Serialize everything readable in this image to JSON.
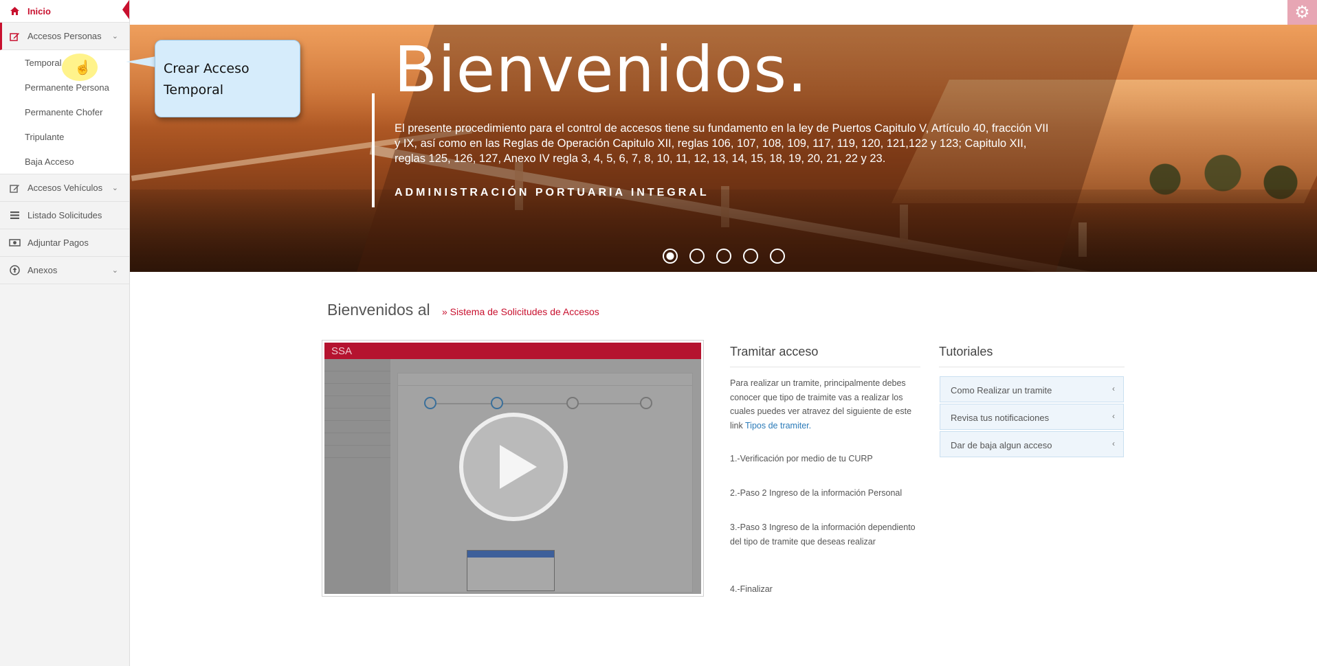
{
  "sidebar": {
    "home": {
      "label": "Inicio",
      "icon": "home-icon"
    },
    "items": [
      {
        "label": "Accesos Personas",
        "icon": "edit-icon",
        "expanded": true,
        "children": [
          "Temporal",
          "Permanente Persona",
          "Permanente Chofer",
          "Tripulante",
          "Baja Acceso"
        ]
      },
      {
        "label": "Accesos Vehículos",
        "icon": "edit-icon"
      },
      {
        "label": "Listado Solicitudes",
        "icon": "list-icon"
      },
      {
        "label": "Adjuntar Pagos",
        "icon": "money-icon"
      },
      {
        "label": "Anexos",
        "icon": "upload-circle-icon"
      }
    ]
  },
  "callout": {
    "line1": "Crear Acceso",
    "line2": "Temporal"
  },
  "hero": {
    "title": "Bienvenidos.",
    "body": "El presente procedimiento para el control de accesos tiene su fundamento en la ley de Puertos Capitulo V, Artículo 40, fracción VII y IX, así como en las Reglas de Operación Capitulo XII, reglas 106, 107, 108, 109, 117, 119, 120, 121,122 y 123; Capitulo XII, reglas 125, 126, 127, Anexo IV regla 3, 4, 5, 6, 7, 8, 10, 11, 12, 13, 14, 15, 18, 19, 20, 21, 22 y 23.",
    "org": "ADMINISTRACIÓN PORTUARIA INTEGRAL",
    "slides": 5,
    "active_slide": 1
  },
  "main": {
    "welcome": "Bienvenidos al",
    "welcome_link": "» Sistema de Solicitudes de Accesos",
    "video": {
      "brand": "SSA"
    }
  },
  "tramitar": {
    "title": "Tramitar acceso",
    "intro": "Para realizar un tramite, principalmente debes conocer que tipo de traimite vas a realizar los cuales puedes ver atravez del siguiente de este link",
    "intro_link": "Tipos de tramiter.",
    "steps": [
      "1.-Verificación por medio de tu CURP",
      "2.-Paso 2 Ingreso de la información Personal",
      "3.-Paso 3 Ingreso de la información dependiento del tipo de tramite que deseas realizar",
      "4.-Finalizar"
    ]
  },
  "tutoriales": {
    "title": "Tutoriales",
    "items": [
      "Como Realizar un tramite",
      "Revisa tus notificaciones",
      "Dar de baja algun acceso"
    ]
  },
  "colors": {
    "accent": "#c8102e",
    "link": "#2a7ab8",
    "gear_bg": "#e7a6b4"
  }
}
